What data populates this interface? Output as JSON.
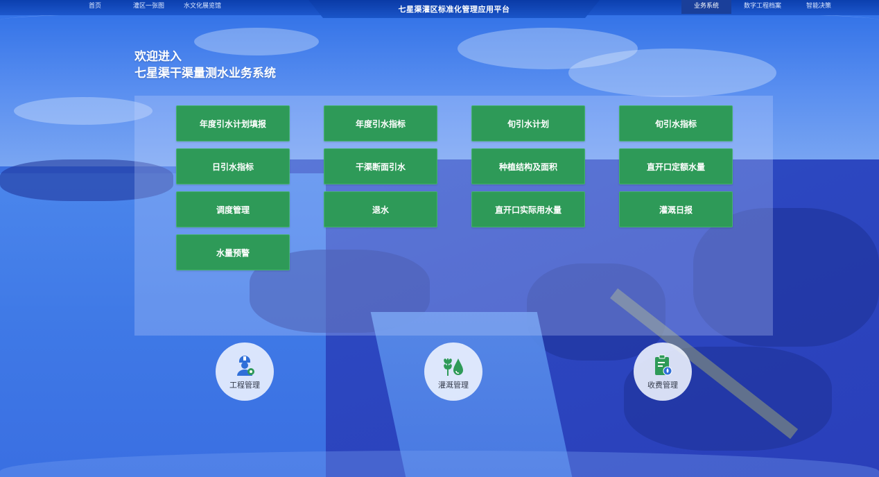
{
  "nav": {
    "left": [
      "首页",
      "灌区一张图",
      "水文化展览馆"
    ],
    "title": "七星渠灌区标准化管理应用平台",
    "right": [
      "业务系统",
      "数字工程档案",
      "智能决策"
    ],
    "active": "业务系统"
  },
  "welcome": {
    "line1": "欢迎进入",
    "line2": "七星渠干渠量测水业务系统"
  },
  "tiles": [
    "年度引水计划填报",
    "年度引水指标",
    "旬引水计划",
    "旬引水指标",
    "日引水指标",
    "干渠断面引水",
    "种植结构及面积",
    "直开口定额水量",
    "调度管理",
    "退水",
    "直开口实际用水量",
    "灌溉日报",
    "水量预警"
  ],
  "modules": [
    {
      "label": "工程管理",
      "icon": "engineer-icon"
    },
    {
      "label": "灌溉管理",
      "icon": "irrigation-icon"
    },
    {
      "label": "收费管理",
      "icon": "billing-icon"
    }
  ],
  "colors": {
    "tile": "#2e9a58",
    "nav": "#0b3fae",
    "icon_blue": "#2f6fd8",
    "icon_green": "#2e9a58"
  }
}
